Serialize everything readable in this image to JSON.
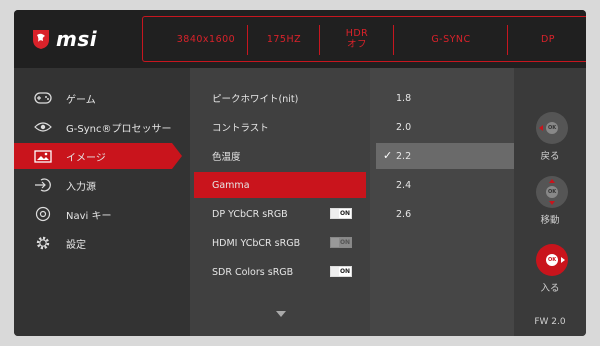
{
  "brand": "msi",
  "status": [
    "3840x1600",
    "175HZ",
    "HDR\nオフ",
    "G-SYNC",
    "DP"
  ],
  "menu": [
    {
      "label": "ゲーム",
      "icon": "gamepad-icon"
    },
    {
      "label": "G-Sync®プロセッサー",
      "icon": "eye-icon"
    },
    {
      "label": "イメージ",
      "icon": "image-icon",
      "active": true
    },
    {
      "label": "入力源",
      "icon": "input-icon"
    },
    {
      "label": "Navi キー",
      "icon": "navi-key-icon"
    },
    {
      "label": "設定",
      "icon": "gear-icon"
    }
  ],
  "submenu": [
    {
      "label": "ピークホワイト(nit)"
    },
    {
      "label": "コントラスト"
    },
    {
      "label": "色温度"
    },
    {
      "label": "Gamma",
      "active": true
    },
    {
      "label": "DP YCbCR sRGB",
      "toggle": "ON"
    },
    {
      "label": "HDMI YCbCR sRGB",
      "toggle": "ON",
      "dim": true
    },
    {
      "label": "SDR Colors sRGB",
      "toggle": "ON"
    }
  ],
  "values": [
    {
      "label": "1.8"
    },
    {
      "label": "2.0"
    },
    {
      "label": "2.2",
      "selected": true
    },
    {
      "label": "2.4"
    },
    {
      "label": "2.6"
    }
  ],
  "nav": {
    "back_label": "戻る",
    "move_label": "移動",
    "enter_label": "入る",
    "ok_label": "OK"
  },
  "firmware": "FW  2.0",
  "colors": {
    "accent": "#c9141c",
    "status_text": "#d9222a"
  }
}
